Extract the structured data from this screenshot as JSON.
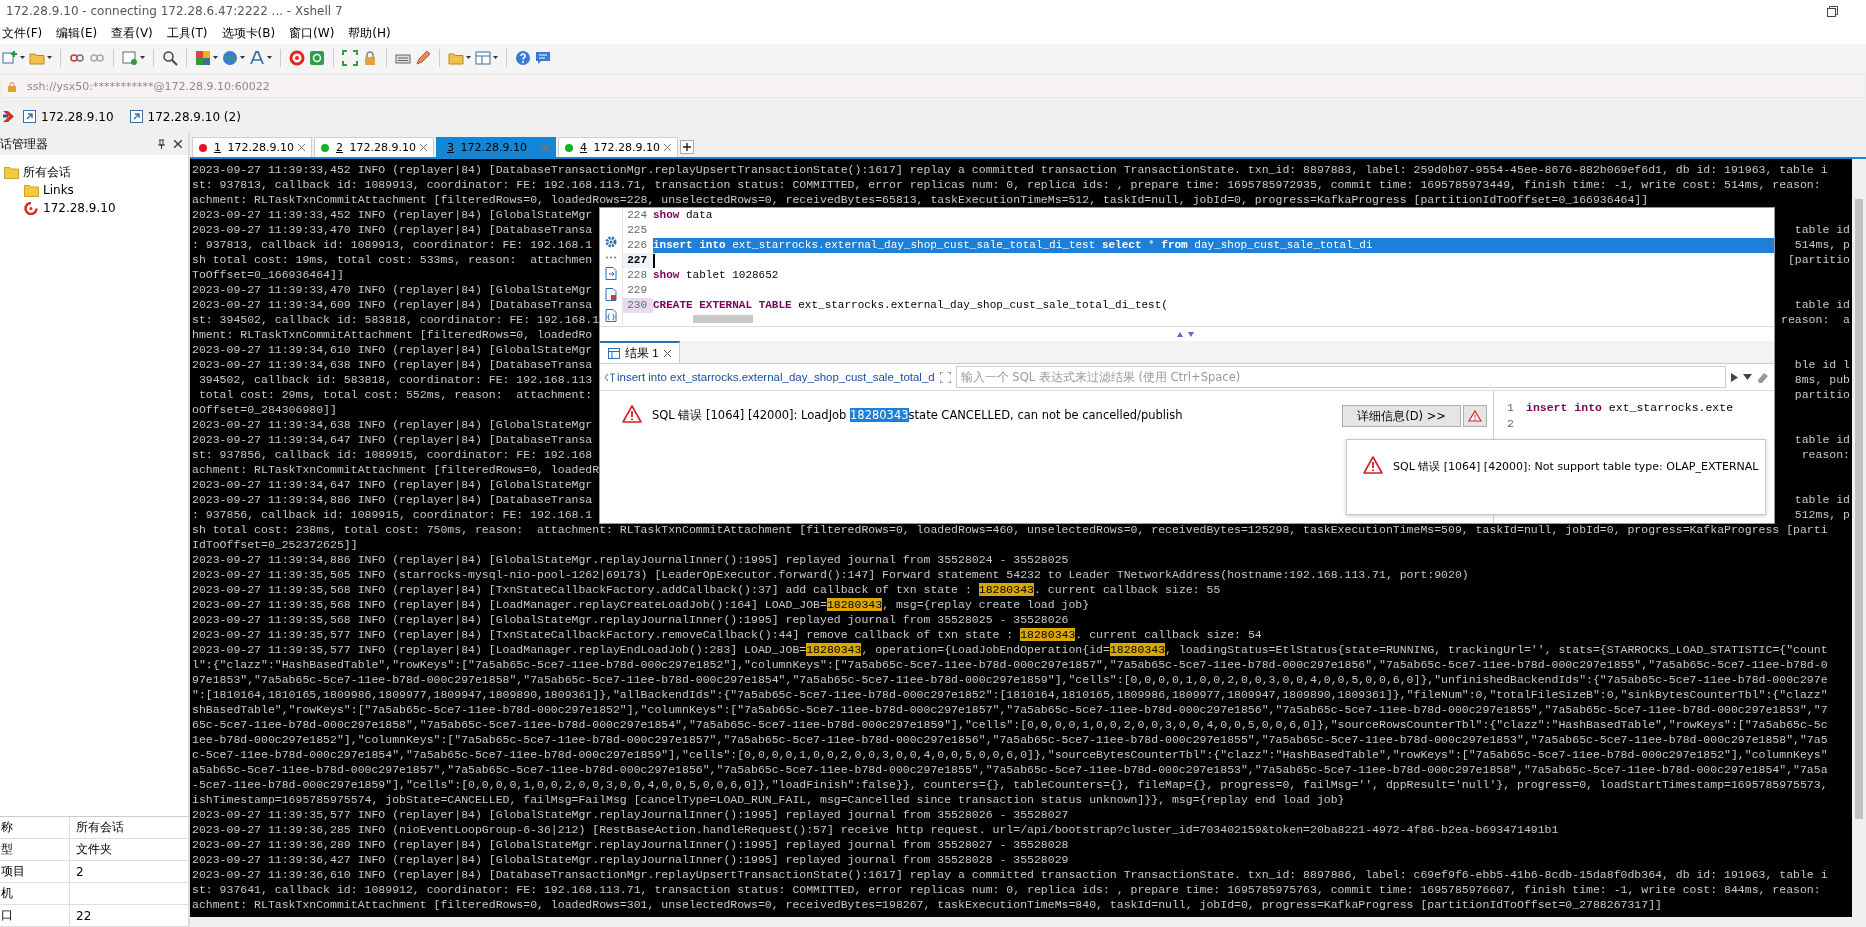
{
  "window": {
    "title": "172.28.9.10 - connecting 172.28.6.47:2222 ... - Xshell 7"
  },
  "menu": [
    "文件(F)",
    "编辑(E)",
    "查看(V)",
    "工具(T)",
    "选项卡(B)",
    "窗口(W)",
    "帮助(H)"
  ],
  "address_bar": {
    "value": "ssh://ysx50:***********@172.28.9.10:60022"
  },
  "links_bar": [
    {
      "label": "172.28.9.10"
    },
    {
      "label": "172.28.9.10 (2)"
    }
  ],
  "session_manager": {
    "title": "话管理器",
    "tree": [
      {
        "label": "所有会话",
        "kind": "folder",
        "children": [
          {
            "label": "Links",
            "kind": "folder"
          },
          {
            "label": "172.28.9.10",
            "kind": "session"
          }
        ]
      }
    ],
    "properties": [
      {
        "name": "称",
        "value": "所有会话"
      },
      {
        "name": "型",
        "value": "文件夹"
      },
      {
        "name": "项目",
        "value": "2"
      },
      {
        "name": "机"
      },
      {
        "name": "口",
        "value": "22"
      }
    ]
  },
  "tabs": [
    {
      "number": "1",
      "label": "172.28.9.10",
      "color": "#e81123",
      "selected": false
    },
    {
      "number": "2",
      "label": "172.28.9.10",
      "color": "#16b02a",
      "selected": false
    },
    {
      "number": "3",
      "label": "172.28.9.10",
      "selected": true
    },
    {
      "number": "4",
      "label": "172.28.9.10",
      "color": "#16b02a",
      "selected": false
    }
  ],
  "terminal": {
    "lines": [
      {
        "text": "2023-09-27 11:39:33,452 INFO (replayer|84) [DatabaseTransactionMgr.replayUpsertTransactionState():1617] replay a committed transaction TransactionState. txn_id: 8897883, label: 259d0b07-9554-45ee-8676-882b069ef6d1, db id: 191963, table i"
      },
      {
        "text": "st: 937813, callback id: 1089913, coordinator: FE: 192.168.113.71, transaction status: COMMITTED, error replicas num: 0, replica ids: , prepare time: 1695785972935, commit time: 1695785973449, finish time: -1, write cost: 514ms, reason:"
      },
      {
        "text": "achment: RLTaskTxnCommitAttachment [filteredRows=0, loadedRows=228, unselectedRows=0, receivedBytes=65813, taskExecutionTimeMs=512, taskId=null, jobId=0, progress=KafkaProgress [partitionIdToOffset=0_166936464]]"
      },
      {
        "text": "2023-09-27 11:39:33,452 INFO (replayer|84) [GlobalStateMgr"
      },
      {
        "text": "2023-09-27 11:39:33,470 INFO (replayer|84) [DatabaseTransa",
        "right": "table id"
      },
      {
        "text": ": 937813, callback id: 1089913, coordinator: FE: 192.168.1",
        "right": "514ms, p"
      },
      {
        "text": "sh total cost: 19ms, total cost: 533ms, reason:  attachmen",
        "right": "[partitio"
      },
      {
        "text": "ToOffset=0_166936464]]"
      },
      {
        "text": "2023-09-27 11:39:33,470 INFO (replayer|84) [GlobalStateMgr"
      },
      {
        "text": "2023-09-27 11:39:34,609 INFO (replayer|84) [DatabaseTransa",
        "right": "table id"
      },
      {
        "text": "st: 394502, callback id: 583818, coordinator: FE: 192.168.1",
        "right": "reason:  a"
      },
      {
        "text": "hment: RLTaskTxnCommitAttachment [filteredRows=0, loadedRo"
      },
      {
        "text": "2023-09-27 11:39:34,610 INFO (replayer|84) [GlobalStateMgr"
      },
      {
        "text": "2023-09-27 11:39:34,638 INFO (replayer|84) [DatabaseTransa",
        "right": "ble id l"
      },
      {
        "text": " 394502, callback id: 583818, coordinator: FE: 192.168.113",
        "right": "8ms, pub"
      },
      {
        "text": " total cost: 29ms, total cost: 552ms, reason:  attachment:",
        "right": "partitio"
      },
      {
        "text": "oOffset=0_284306980]]"
      },
      {
        "text": "2023-09-27 11:39:34,638 INFO (replayer|84) [GlobalStateMgr"
      },
      {
        "text": "2023-09-27 11:39:34,647 INFO (replayer|84) [DatabaseTransa",
        "right": "table id"
      },
      {
        "text": "st: 937856, callback id: 1089915, coordinator: FE: 192.168",
        "right": "reason:"
      },
      {
        "text": "achment: RLTaskTxnCommitAttachment [filteredRows=0, loadedR"
      },
      {
        "text": "2023-09-27 11:39:34,647 INFO (replayer|84) [GlobalStateMgr"
      },
      {
        "text": "2023-09-27 11:39:34,886 INFO (replayer|84) [DatabaseTransa",
        "right": "table id"
      },
      {
        "text": ": 937856, callback id: 1089915, coordinator: FE: 192.168.1",
        "right": "512ms, p"
      },
      {
        "text": "sh total cost: 238ms, total cost: 750ms, reason:  attachment: RLTaskTxnCommitAttachment [filteredRows=0, loadedRows=460, unselectedRows=0, receivedBytes=125298, taskExecutionTimeMs=509, taskId=null, jobId=0, progress=KafkaProgress [parti"
      },
      {
        "text": "IdToOffset=0_252372625]]"
      },
      {
        "text": "2023-09-27 11:39:34,886 INFO (replayer|84) [GlobalStateMgr.replayJournalInner():1995] replayed journal from 35528024 - 35528025"
      },
      {
        "text": "2023-09-27 11:39:35,505 INFO (starrocks-mysql-nio-pool-1262|69173) [LeaderOpExecutor.forward():147] Forward statement 54232 to Leader TNetworkAddress(hostname:192.168.113.71, port:9020)"
      },
      {
        "parts": [
          {
            "text": "2023-09-27 11:39:35,568 INFO (replayer|84) [TxnStateCallbackFactory.addCallback():37] add callback of txn state : ",
            "highlighted": false
          },
          {
            "text": "18280343",
            "highlighted": true
          },
          {
            "text": ". current callback size: 55",
            "highlighted": false
          }
        ]
      },
      {
        "parts": [
          {
            "text": "2023-09-27 11:39:35,568 INFO (replayer|84) [LoadManager.replayCreateLoadJob():164] LOAD_JOB=",
            "highlighted": false
          },
          {
            "text": "18280343",
            "highlighted": true
          },
          {
            "text": ", msg={replay create load job}",
            "highlighted": false
          }
        ]
      },
      {
        "text": "2023-09-27 11:39:35,568 INFO (replayer|84) [GlobalStateMgr.replayJournalInner():1995] replayed journal from 35528025 - 35528026"
      },
      {
        "parts": [
          {
            "text": "2023-09-27 11:39:35,577 INFO (replayer|84) [TxnStateCallbackFactory.removeCallback():44] remove callback of txn state : ",
            "highlighted": false
          },
          {
            "text": "18280343",
            "highlighted": true
          },
          {
            "text": ". current callback size: 54",
            "highlighted": false
          }
        ]
      },
      {
        "parts": [
          {
            "text": "2023-09-27 11:39:35,577 INFO (replayer|84) [LoadManager.replayEndLoadJob():283] LOAD_JOB=",
            "highlighted": false
          },
          {
            "text": "18280343",
            "highlighted": true
          },
          {
            "text": ", operation={LoadJobEndOperation{id=",
            "highlighted": false
          },
          {
            "text": "18280343",
            "highlighted": true
          },
          {
            "text": ", loadingStatus=EtlStatus{state=RUNNING, trackingUrl='', stats={STARROCKS_LOAD_STATISTIC={\"count",
            "highlighted": false
          }
        ]
      },
      {
        "text": "l\":{\"clazz\":\"HashBasedTable\",\"rowKeys\":[\"7a5ab65c-5ce7-11ee-b78d-000c297e1852\"],\"columnKeys\":[\"7a5ab65c-5ce7-11ee-b78d-000c297e1857\",\"7a5ab65c-5ce7-11ee-b78d-000c297e1856\",\"7a5ab65c-5ce7-11ee-b78d-000c297e1855\",\"7a5ab65c-5ce7-11ee-b78d-0"
      },
      {
        "text": "97e1853\",\"7a5ab65c-5ce7-11ee-b78d-000c297e1858\",\"7a5ab65c-5ce7-11ee-b78d-000c297e1854\",\"7a5ab65c-5ce7-11ee-b78d-000c297e1859\"],\"cells\":[0,0,0,0,1,0,0,2,0,0,3,0,0,4,0,0,5,0,0,6,0]},\"unfinishedBackendIds\":{\"7a5ab65c-5ce7-11ee-b78d-000c297e"
      },
      {
        "text": "\":[1810164,1810165,1809986,1809977,1809947,1809890,1809361]},\"allBackendIds\":{\"7a5ab65c-5ce7-11ee-b78d-000c297e1852\":[1810164,1810165,1809986,1809977,1809947,1809890,1809361]},\"fileNum\":0,\"totalFileSizeB\":0,\"sinkBytesCounterTbl\":{\"clazz\""
      },
      {
        "text": "shBasedTable\",\"rowKeys\":[\"7a5ab65c-5ce7-11ee-b78d-000c297e1852\"],\"columnKeys\":[\"7a5ab65c-5ce7-11ee-b78d-000c297e1857\",\"7a5ab65c-5ce7-11ee-b78d-000c297e1856\",\"7a5ab65c-5ce7-11ee-b78d-000c297e1855\",\"7a5ab65c-5ce7-11ee-b78d-000c297e1853\",\"7"
      },
      {
        "text": "65c-5ce7-11ee-b78d-000c297e1858\",\"7a5ab65c-5ce7-11ee-b78d-000c297e1854\",\"7a5ab65c-5ce7-11ee-b78d-000c297e1859\"],\"cells\":[0,0,0,0,1,0,0,2,0,0,3,0,0,4,0,0,5,0,0,6,0]},\"sourceRowsCounterTbl\":{\"clazz\":\"HashBasedTable\",\"rowKeys\":[\"7a5ab65c-5c"
      },
      {
        "text": "1ee-b78d-000c297e1852\"],\"columnKeys\":[\"7a5ab65c-5ce7-11ee-b78d-000c297e1857\",\"7a5ab65c-5ce7-11ee-b78d-000c297e1856\",\"7a5ab65c-5ce7-11ee-b78d-000c297e1855\",\"7a5ab65c-5ce7-11ee-b78d-000c297e1853\",\"7a5ab65c-5ce7-11ee-b78d-000c297e1858\",\"7a5"
      },
      {
        "text": "c-5ce7-11ee-b78d-000c297e1854\",\"7a5ab65c-5ce7-11ee-b78d-000c297e1859\"],\"cells\":[0,0,0,0,1,0,0,2,0,0,3,0,0,4,0,0,5,0,0,6,0]},\"sourceBytesCounterTbl\":{\"clazz\":\"HashBasedTable\",\"rowKeys\":[\"7a5ab65c-5ce7-11ee-b78d-000c297e1852\"],\"columnKeys\""
      },
      {
        "text": "a5ab65c-5ce7-11ee-b78d-000c297e1857\",\"7a5ab65c-5ce7-11ee-b78d-000c297e1856\",\"7a5ab65c-5ce7-11ee-b78d-000c297e1855\",\"7a5ab65c-5ce7-11ee-b78d-000c297e1853\",\"7a5ab65c-5ce7-11ee-b78d-000c297e1858\",\"7a5ab65c-5ce7-11ee-b78d-000c297e1854\",\"7a5a"
      },
      {
        "text": "-5ce7-11ee-b78d-000c297e1859\"],\"cells\":[0,0,0,0,1,0,0,2,0,0,3,0,0,4,0,0,5,0,0,6,0]},\"loadFinish\":false}}, counters={}, tableCounters={}, fileMap={}, progress=0, failMsg='', dppResult='null'}, progress=0, loadStartTimestamp=1695785975573,"
      },
      {
        "text": "ishTimestamp=1695785975574, jobState=CANCELLED, failMsg=FailMsg [cancelType=LOAD_RUN_FAIL, msg=Cancelled since transaction status unknown]}}, msg={replay end load job}"
      },
      {
        "text": "2023-09-27 11:39:35,577 INFO (replayer|84) [GlobalStateMgr.replayJournalInner():1995] replayed journal from 35528026 - 35528027"
      },
      {
        "text": "2023-09-27 11:39:36,285 INFO (nioEventLoopGroup-6-36|212) [RestBaseAction.handleRequest():57] receive http request. url=/api/bootstrap?cluster_id=703402159&token=20ba8221-4972-4f86-b2ea-b693471491b1"
      },
      {
        "text": "2023-09-27 11:39:36,289 INFO (replayer|84) [GlobalStateMgr.replayJournalInner():1995] replayed journal from 35528027 - 35528028"
      },
      {
        "text": "2023-09-27 11:39:36,427 INFO (replayer|84) [GlobalStateMgr.replayJournalInner():1995] replayed journal from 35528028 - 35528029"
      },
      {
        "text": "2023-09-27 11:39:36,610 INFO (replayer|84) [DatabaseTransactionMgr.replayUpsertTransactionState():1617] replay a committed transaction TransactionState. txn_id: 8897886, label: c69ef9f6-ebb5-41b6-8cdb-15da8f0db364, db id: 191963, table i"
      },
      {
        "text": "st: 937641, callback id: 1089912, coordinator: FE: 192.168.113.71, transaction status: COMMITTED, error replicas num: 0, replica ids: , prepare time: 1695785975763, commit time: 1695785976607, finish time: -1, write cost: 844ms, reason:"
      },
      {
        "text": "achment: RLTaskTxnCommitAttachment [filteredRows=0, loadedRows=301, unselectedRows=0, receivedBytes=198267, taskExecutionTimeMs=840, taskId=null, jobId=0, progress=KafkaProgress [partitionIdToOffset=0_2788267317]]"
      }
    ]
  },
  "sql_editor": {
    "lines": [
      {
        "number": "224",
        "text": "**show** data",
        "marked": false,
        "selected": false,
        "cursor": false
      },
      {
        "number": "225",
        "marked": false,
        "selected": false,
        "cursor": false
      },
      {
        "number": "226",
        "text": "**insert** **into** ext_starrocks.external_day_shop_cust_sale_total_di_test **select** * **from** day_shop_cust_sale_total_di",
        "marked": true,
        "selected": true,
        "cursor": false
      },
      {
        "number": "227",
        "marked": false,
        "selected": false,
        "cursor": true
      },
      {
        "number": "228",
        "text": "**show** tablet 1028652",
        "marked": false,
        "selected": false,
        "cursor": false
      },
      {
        "number": "229",
        "marked": false,
        "selected": false,
        "cursor": false
      },
      {
        "number": "230",
        "text": "**CREATE** **EXTERNAL** **TABLE** ext_starrocks.external_day_shop_cust_sale_total_di_test(",
        "marked": true,
        "selected": false,
        "cursor": false
      }
    ],
    "results_tab": {
      "label": "结果 1"
    },
    "filter": {
      "query": "insert into ext_starrocks.external_day_shop_cust_sale_total_d",
      "placeholder": "输入一个 SQL 表达式来过滤结果 (使用 Ctrl+Space)"
    },
    "error": {
      "parts": [
        {
          "text": "SQL 错误 [1064] [42000]: LoadJob ",
          "highlighted": false
        },
        {
          "text": "18280343",
          "highlighted": true
        },
        {
          "text": "state CANCELLED, can not be cancelled/publish",
          "highlighted": false
        }
      ]
    },
    "details_button": {
      "label": "详细信息(D) >>"
    },
    "query_panel": {
      "lines": [
        {
          "number": "1",
          "text": "**insert** **into** ext_starrocks.exte"
        },
        {
          "number": "2"
        }
      ]
    }
  },
  "notification": {
    "message": "SQL 错误 [1064] [42000]: Not support table type: OLAP_EXTERNAL"
  }
}
